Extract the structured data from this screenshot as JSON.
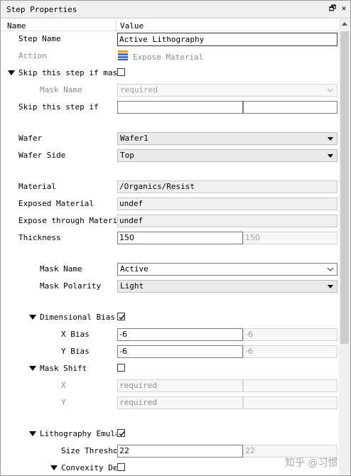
{
  "window": {
    "title": "Step Properties",
    "float_glyph": "🗗",
    "close_glyph": "✕"
  },
  "columns": {
    "name": "Name",
    "value": "Value"
  },
  "step_name": {
    "label": "Step Name",
    "value": "Active Lithography"
  },
  "action": {
    "label": "Action",
    "value": "Expose Material",
    "icon": "stack-icon"
  },
  "skip_if_mask": {
    "label": "Skip this step if mask",
    "checked": false
  },
  "mask_name_top": {
    "label": "Mask Name",
    "value": "required"
  },
  "skip_if": {
    "label": "Skip this step if",
    "value1": "",
    "value2": ""
  },
  "wafer": {
    "label": "Wafer",
    "value": "Wafer1"
  },
  "wafer_side": {
    "label": "Wafer Side",
    "value": "Top"
  },
  "material": {
    "label": "Material",
    "value": "/Organics/Resist"
  },
  "exposed_material": {
    "label": "Exposed Material",
    "value": "undef"
  },
  "expose_through": {
    "label": "Expose through Material",
    "value": "undef"
  },
  "thickness": {
    "label": "Thickness",
    "value": "150",
    "default": "150"
  },
  "mask_name": {
    "label": "Mask Name",
    "value": "Active"
  },
  "mask_polarity": {
    "label": "Mask Polarity",
    "value": "Light"
  },
  "dimensional_bias": {
    "label": "Dimensional Bias",
    "checked": true
  },
  "x_bias": {
    "label": "X Bias",
    "value": "-6",
    "default": "-6"
  },
  "y_bias": {
    "label": "Y Bias",
    "value": "-6",
    "default": "-6"
  },
  "mask_shift": {
    "label": "Mask Shift",
    "checked": false
  },
  "x_shift": {
    "label": "X",
    "value": "required"
  },
  "y_shift": {
    "label": "Y",
    "value": "required"
  },
  "litho_emulation": {
    "label": "Lithography Emulat",
    "checked": true
  },
  "size_threshold": {
    "label": "Size Threshol",
    "value": "22",
    "default": "22"
  },
  "convexity": {
    "label": "Convexity Dep",
    "checked": false
  },
  "watermark": "知乎 @习惯",
  "colors": {
    "titlebar": "#f0f0f0",
    "readonly_field": "#f0f0f0",
    "combo": "#e9e9e9",
    "disabled_text": "#8c8c8c"
  }
}
